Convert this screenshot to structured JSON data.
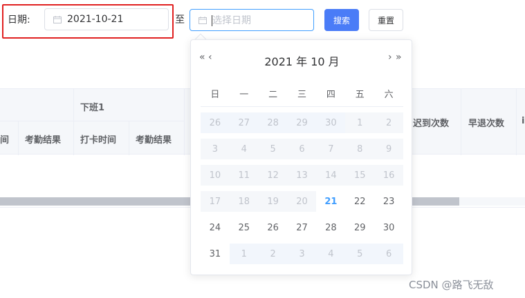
{
  "filter": {
    "date_label": "日期:",
    "start_value": "2021-10-21",
    "to_label": "至",
    "end_placeholder": "选择日期",
    "search_label": "搜索",
    "reset_label": "重置"
  },
  "table": {
    "group_header": "下班1",
    "headers": [
      "间",
      "考勤结果",
      "打卡时间",
      "考勤结果",
      "迟到次数",
      "早退次数",
      "i"
    ]
  },
  "picker": {
    "title": "2021 年  10 月",
    "prev_year": "«",
    "prev_month": "‹",
    "next_month": "›",
    "next_year": "»",
    "weekdays": [
      "日",
      "一",
      "二",
      "三",
      "四",
      "五",
      "六"
    ],
    "weeks": [
      [
        [
          "26",
          "off"
        ],
        [
          "27",
          "off"
        ],
        [
          "28",
          "off"
        ],
        [
          "29",
          "off"
        ],
        [
          "30",
          "off"
        ],
        [
          "1",
          "dis"
        ],
        [
          "2",
          "dis"
        ]
      ],
      [
        [
          "3",
          "dis"
        ],
        [
          "4",
          "dis"
        ],
        [
          "5",
          "dis"
        ],
        [
          "6",
          "dis"
        ],
        [
          "7",
          "dis"
        ],
        [
          "8",
          "dis"
        ],
        [
          "9",
          "dis"
        ]
      ],
      [
        [
          "10",
          "dis"
        ],
        [
          "11",
          "dis"
        ],
        [
          "12",
          "dis"
        ],
        [
          "13",
          "dis"
        ],
        [
          "14",
          "dis"
        ],
        [
          "15",
          "dis"
        ],
        [
          "16",
          "dis"
        ]
      ],
      [
        [
          "17",
          "dis"
        ],
        [
          "18",
          "dis"
        ],
        [
          "19",
          "dis"
        ],
        [
          "20",
          "dis"
        ],
        [
          "21",
          "today"
        ],
        [
          "22",
          "cur"
        ],
        [
          "23",
          "cur"
        ]
      ],
      [
        [
          "24",
          "cur"
        ],
        [
          "25",
          "cur"
        ],
        [
          "26",
          "cur"
        ],
        [
          "27",
          "cur"
        ],
        [
          "28",
          "cur"
        ],
        [
          "29",
          "cur"
        ],
        [
          "30",
          "cur"
        ]
      ],
      [
        [
          "31",
          "cur"
        ],
        [
          "1",
          "off"
        ],
        [
          "2",
          "off"
        ],
        [
          "3",
          "off"
        ],
        [
          "4",
          "off"
        ],
        [
          "5",
          "off"
        ],
        [
          "6",
          "off"
        ]
      ]
    ]
  },
  "watermark": "CSDN @路飞无敌",
  "colors": {
    "primary": "#409eff",
    "search_button": "#4a7cf7",
    "highlight_border": "#e02020"
  },
  "icons": {
    "calendar": "calendar-icon"
  }
}
